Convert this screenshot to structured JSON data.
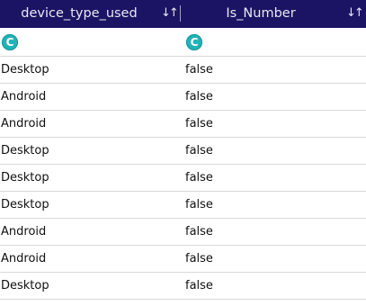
{
  "columns": [
    {
      "name": "device_type_used",
      "sort_icon": "sort-icon",
      "type_icon": "C"
    },
    {
      "name": "Is_Number",
      "sort_icon": "sort-icon",
      "type_icon": "C"
    }
  ],
  "sort_glyph": "↓↑",
  "rows": [
    {
      "device_type_used": "Desktop",
      "Is_Number": "false"
    },
    {
      "device_type_used": "Android",
      "Is_Number": "false"
    },
    {
      "device_type_used": "Android",
      "Is_Number": "false"
    },
    {
      "device_type_used": "Desktop",
      "Is_Number": "false"
    },
    {
      "device_type_used": "Desktop",
      "Is_Number": "false"
    },
    {
      "device_type_used": "Desktop",
      "Is_Number": "false"
    },
    {
      "device_type_used": "Android",
      "Is_Number": "false"
    },
    {
      "device_type_used": "Android",
      "Is_Number": "false"
    },
    {
      "device_type_used": "Desktop",
      "Is_Number": "false"
    }
  ],
  "colors": {
    "header_bg": "#1b1464",
    "type_icon_bg": "#21b3b8",
    "row_border": "#d9d9d9"
  }
}
